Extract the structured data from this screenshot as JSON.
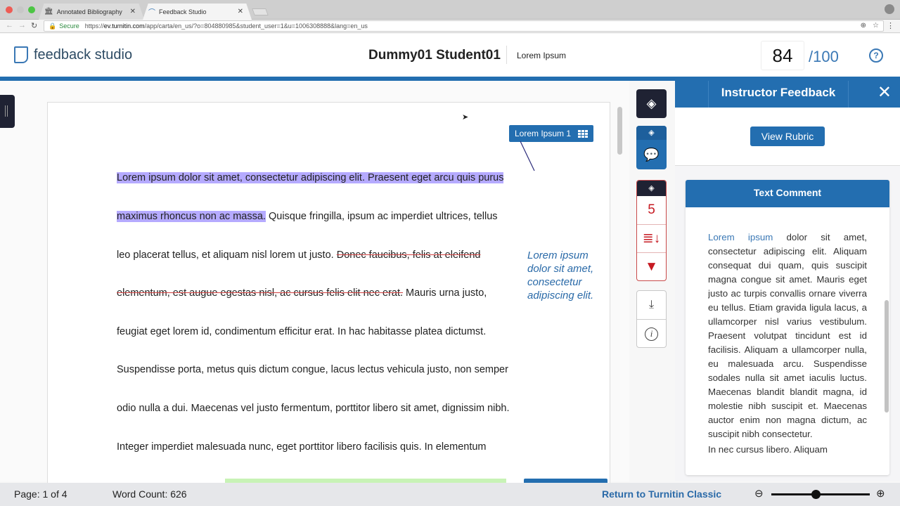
{
  "browser": {
    "tabs": [
      {
        "label": "Annotated Bibliography",
        "icon": "blackboard-icon"
      },
      {
        "label": "Feedback Studio",
        "icon": "turnitin-icon",
        "active": true
      }
    ],
    "secure_label": "Secure",
    "url_prefix": "https://",
    "url_host": "ev.turnitin.com",
    "url_path": "/app/carta/en_us/?o=804880985&student_user=1&u=1006308888&lang=en_us"
  },
  "header": {
    "logo_text": "feedback studio",
    "student_name": "Dummy01 Student01",
    "assignment": "Lorem Ipsum",
    "score": "84",
    "score_max": "/100",
    "help_label": "?"
  },
  "document": {
    "lines": [
      {
        "hl": "Lorem ipsum dolor sit amet, consectetur adipiscing elit. Praesent eget arcu quis purus"
      },
      {
        "hl": "maximus rhoncus non ac massa.",
        "after": " Quisque fringilla, ipsum ac imperdiet ultrices, tellus"
      },
      {
        "before": "leo placerat tellus, et aliquam nisl lorem ut justo. ",
        "strike": "Donec faucibus, felis at eleifend"
      },
      {
        "strike": "elementum, est augue egestas nisl, ac cursus felis elit nec erat.",
        "after": " Mauris urna justo,"
      },
      {
        "text": "feugiat eget lorem id, condimentum efficitur erat. In hac habitasse platea dictumst."
      },
      {
        "text": "Suspendisse porta, metus quis dictum congue, lacus lectus vehicula justo, non semper"
      },
      {
        "text": "odio nulla a dui. Maecenas vel justo fermentum, porttitor libero sit amet, dignissim nibh."
      },
      {
        "text": "Integer imperdiet malesuada nunc, eget porttitor libero facilisis quis. In elementum"
      }
    ],
    "quickmark_label": "Lorem Ipsum 1",
    "margin_note": [
      "Lorem ipsum",
      "dolor sit amet,",
      "consectetur",
      "adipiscing elit."
    ]
  },
  "toolbar": {
    "count_value": "5"
  },
  "panel": {
    "title": "Instructor Feedback",
    "view_rubric": "View Rubric",
    "card_title": "Text Comment",
    "comment_link": "Lorem ipsum",
    "comment_text": " dolor sit amet, consectetur adipiscing elit. Aliquam consequat dui quam, quis suscipit magna congue sit amet. Mauris eget justo ac turpis convallis ornare viverra eu tellus. Etiam gravida ligula lacus, a ullamcorper nisl varius vestibulum. Praesent volutpat tincidunt est id facilisis. Aliquam a ullamcorper nulla, eu malesuada arcu. Suspendisse sodales nulla sit amet iaculis luctus. Maecenas blandit blandit magna, id molestie nibh suscipit et. Maecenas auctor enim non magna dictum, ac suscipit nibh consectetur.",
    "comment_text_2": "In nec cursus libero. Aliquam"
  },
  "footer": {
    "page": "Page: 1 of 4",
    "word_count": "Word Count: 626",
    "return_link": "Return to Turnitin Classic",
    "zoom_level": 0.45
  }
}
